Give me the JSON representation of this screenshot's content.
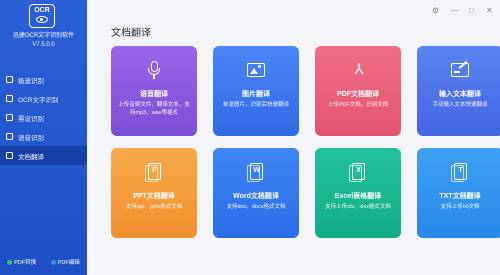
{
  "app": {
    "logo_text": "OCR",
    "name": "迅捷OCR文字识别软件",
    "version": "V7.5.0.0"
  },
  "sidebar": {
    "items": [
      {
        "label": "极速识别"
      },
      {
        "label": "OCR文字识别"
      },
      {
        "label": "票证识别"
      },
      {
        "label": "语音识别"
      },
      {
        "label": "文档翻译",
        "active": true
      }
    ],
    "footer": [
      {
        "label": "PDF转换",
        "color": "#2ecc71"
      },
      {
        "label": "PDF编辑",
        "color": "#3498db"
      }
    ]
  },
  "window": {
    "settings": "⚙",
    "minimize": "—",
    "maximize": "□",
    "close": "✕"
  },
  "main": {
    "title": "文档翻译",
    "cards": [
      {
        "icon": "microphone-icon",
        "title": "语音翻译",
        "desc": "上传音频文件，翻译文本，支持mp3、wav等格式"
      },
      {
        "icon": "image-icon",
        "title": "图片翻译",
        "desc": "单张图片，识别后快速翻译"
      },
      {
        "icon": "pdf-icon",
        "title": "PDF文档翻译",
        "desc": "上传PDF文档，识别文档"
      },
      {
        "icon": "edit-text-icon",
        "title": "输入文本翻译",
        "desc": "手动输入文本快速翻译"
      },
      {
        "icon": "ppt-icon",
        "title": "PPT文档翻译",
        "desc": "支持ppt、pptx格式文档",
        "glyph": "P"
      },
      {
        "icon": "word-icon",
        "title": "Word文档翻译",
        "desc": "支持doc、docx格式文档",
        "glyph": "W"
      },
      {
        "icon": "excel-icon",
        "title": "Excel表格翻译",
        "desc": "支持上传xls、xlsx格式文档",
        "glyph": "X"
      },
      {
        "icon": "txt-icon",
        "title": "TXT文档翻译",
        "desc": "支持上传txt文档",
        "glyph": "T"
      }
    ]
  }
}
